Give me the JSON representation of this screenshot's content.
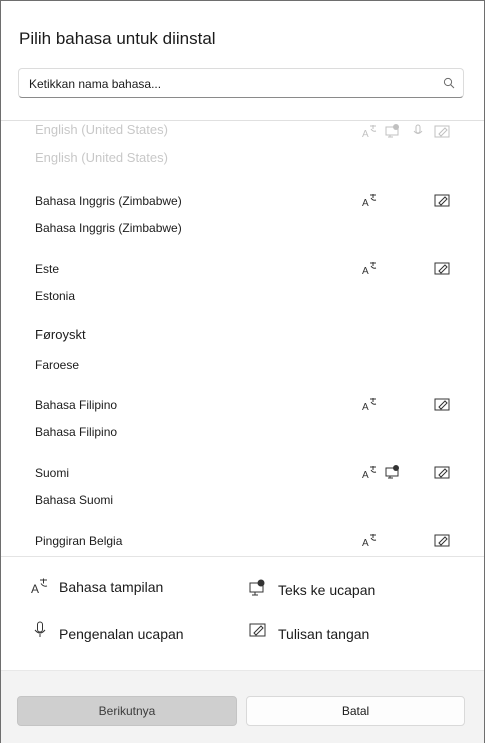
{
  "dialog": {
    "title": "Pilih bahasa untuk diinstal",
    "search": {
      "placeholder": "Ketikkan nama bahasa..."
    }
  },
  "languages": [
    {
      "name": "English (United States)",
      "native": "English (United States)",
      "features": [
        "display-language",
        "text-to-speech",
        "speech-recognition",
        "handwriting"
      ],
      "state": "faded"
    },
    {
      "name": "Bahasa Inggris (Zimbabwe)",
      "native": "Bahasa Inggris (Zimbabwe)",
      "features": [
        "display-language",
        "handwriting"
      ]
    },
    {
      "name": "Este",
      "native": "Estonia",
      "features": [
        "display-language",
        "handwriting"
      ]
    },
    {
      "name": "Føroyskt",
      "native": "Faroese",
      "features": []
    },
    {
      "name": "Bahasa Filipino",
      "native": "Bahasa Filipino",
      "features": [
        "display-language",
        "handwriting"
      ]
    },
    {
      "name": "Suomi",
      "native": "Bahasa Suomi",
      "features": [
        "display-language",
        "text-to-speech",
        "handwriting"
      ]
    },
    {
      "name": "Pinggiran Belgia",
      "native": "",
      "features": [
        "display-language",
        "handwriting"
      ]
    }
  ],
  "legend": {
    "display_language": "Bahasa tampilan",
    "text_to_speech": "Teks ke ucapan",
    "speech_recognition": "Pengenalan ucapan",
    "handwriting": "Tulisan tangan"
  },
  "buttons": {
    "next": "Berikutnya",
    "cancel": "Batal"
  }
}
